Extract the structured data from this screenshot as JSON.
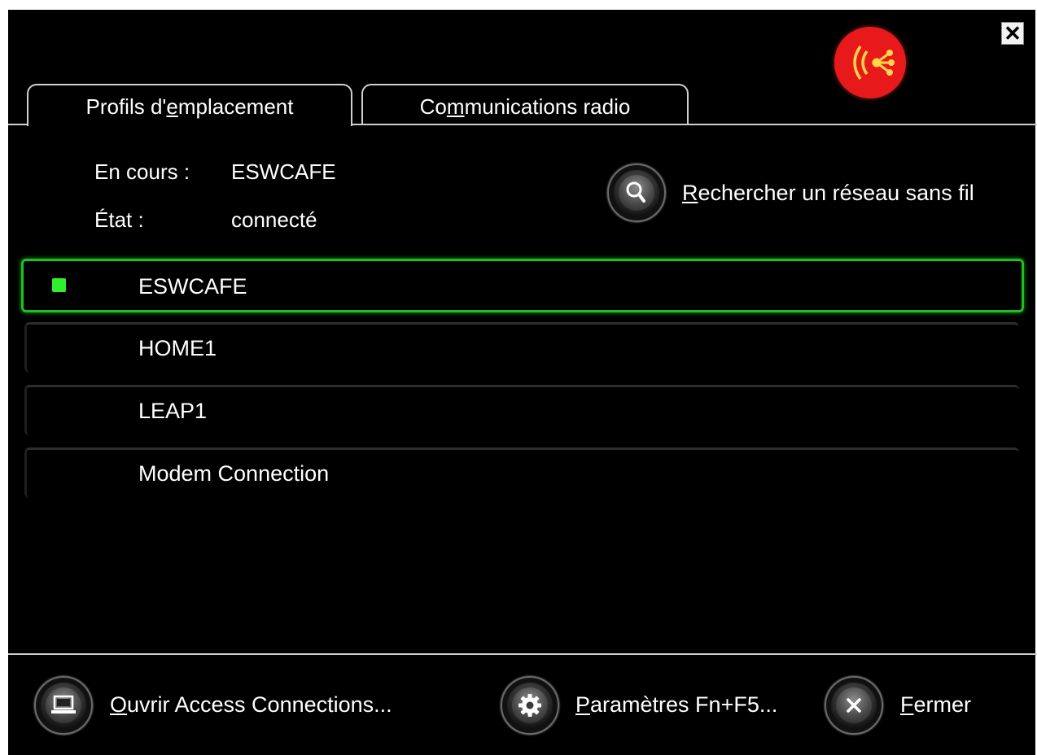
{
  "window": {
    "close_symbol": "✕"
  },
  "tabs": [
    {
      "label_pre": "Profils d'",
      "label_mnemonic": "e",
      "label_post": "mplacement",
      "active": true
    },
    {
      "label_pre": "Co",
      "label_mnemonic": "m",
      "label_post": "munications radio",
      "active": false
    }
  ],
  "status": {
    "current_label": "En cours :",
    "current_value": "ESWCAFE",
    "state_label": "État :",
    "state_value": "connecté"
  },
  "search": {
    "icon": "search-icon",
    "label_mnemonic": "R",
    "label_rest": "echercher un réseau sans fil"
  },
  "profiles": [
    {
      "name": "ESWCAFE",
      "selected": true,
      "connected": true
    },
    {
      "name": "HOME1",
      "selected": false,
      "connected": false
    },
    {
      "name": "LEAP1",
      "selected": false,
      "connected": false
    },
    {
      "name": "Modem Connection",
      "selected": false,
      "connected": false
    }
  ],
  "footer": {
    "open": {
      "icon": "laptop-icon",
      "label_mnemonic": "O",
      "label_rest": "uvrir Access Connections..."
    },
    "settings": {
      "icon": "gear-icon",
      "label_mnemonic": "P",
      "label_rest": "aramètres Fn+F5..."
    },
    "close": {
      "icon": "close-icon",
      "label_mnemonic": "F",
      "label_rest": "ermer"
    }
  },
  "colors": {
    "background": "#000000",
    "accent_green": "#1fbf1f",
    "status_dot": "#2ef02e",
    "brand_red": "#e8191b",
    "brand_yellow": "#ffd84a"
  }
}
